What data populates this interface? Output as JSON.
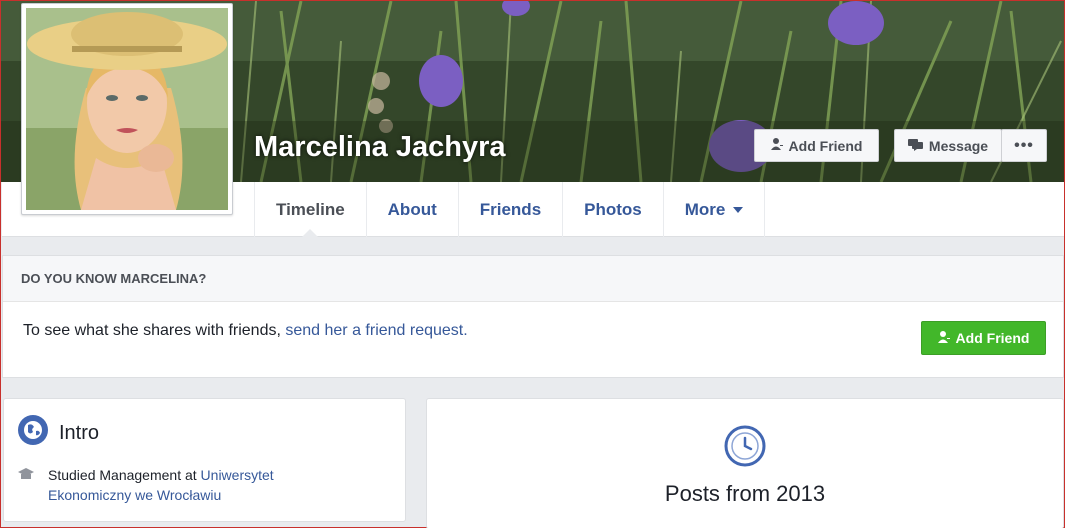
{
  "profile": {
    "name": "Marcelina Jachyra"
  },
  "cover_actions": {
    "add_friend": "Add Friend",
    "message": "Message",
    "more": "•••"
  },
  "tabs": [
    {
      "label": "Timeline",
      "active": true
    },
    {
      "label": "About"
    },
    {
      "label": "Friends"
    },
    {
      "label": "Photos"
    },
    {
      "label": "More"
    }
  ],
  "know_card": {
    "heading": "DO YOU KNOW MARCELINA?",
    "text": "To see what she shares with friends, ",
    "link": "send her a friend request.",
    "button": "Add Friend"
  },
  "intro": {
    "title": "Intro",
    "studied_prefix": "Studied Management at ",
    "school": "Uniwersytet Ekonomiczny we Wrocławiu"
  },
  "posts": {
    "title": "Posts from 2013"
  },
  "colors": {
    "link_blue": "#365899",
    "green": "#42b72a",
    "background": "#e9ebee"
  }
}
